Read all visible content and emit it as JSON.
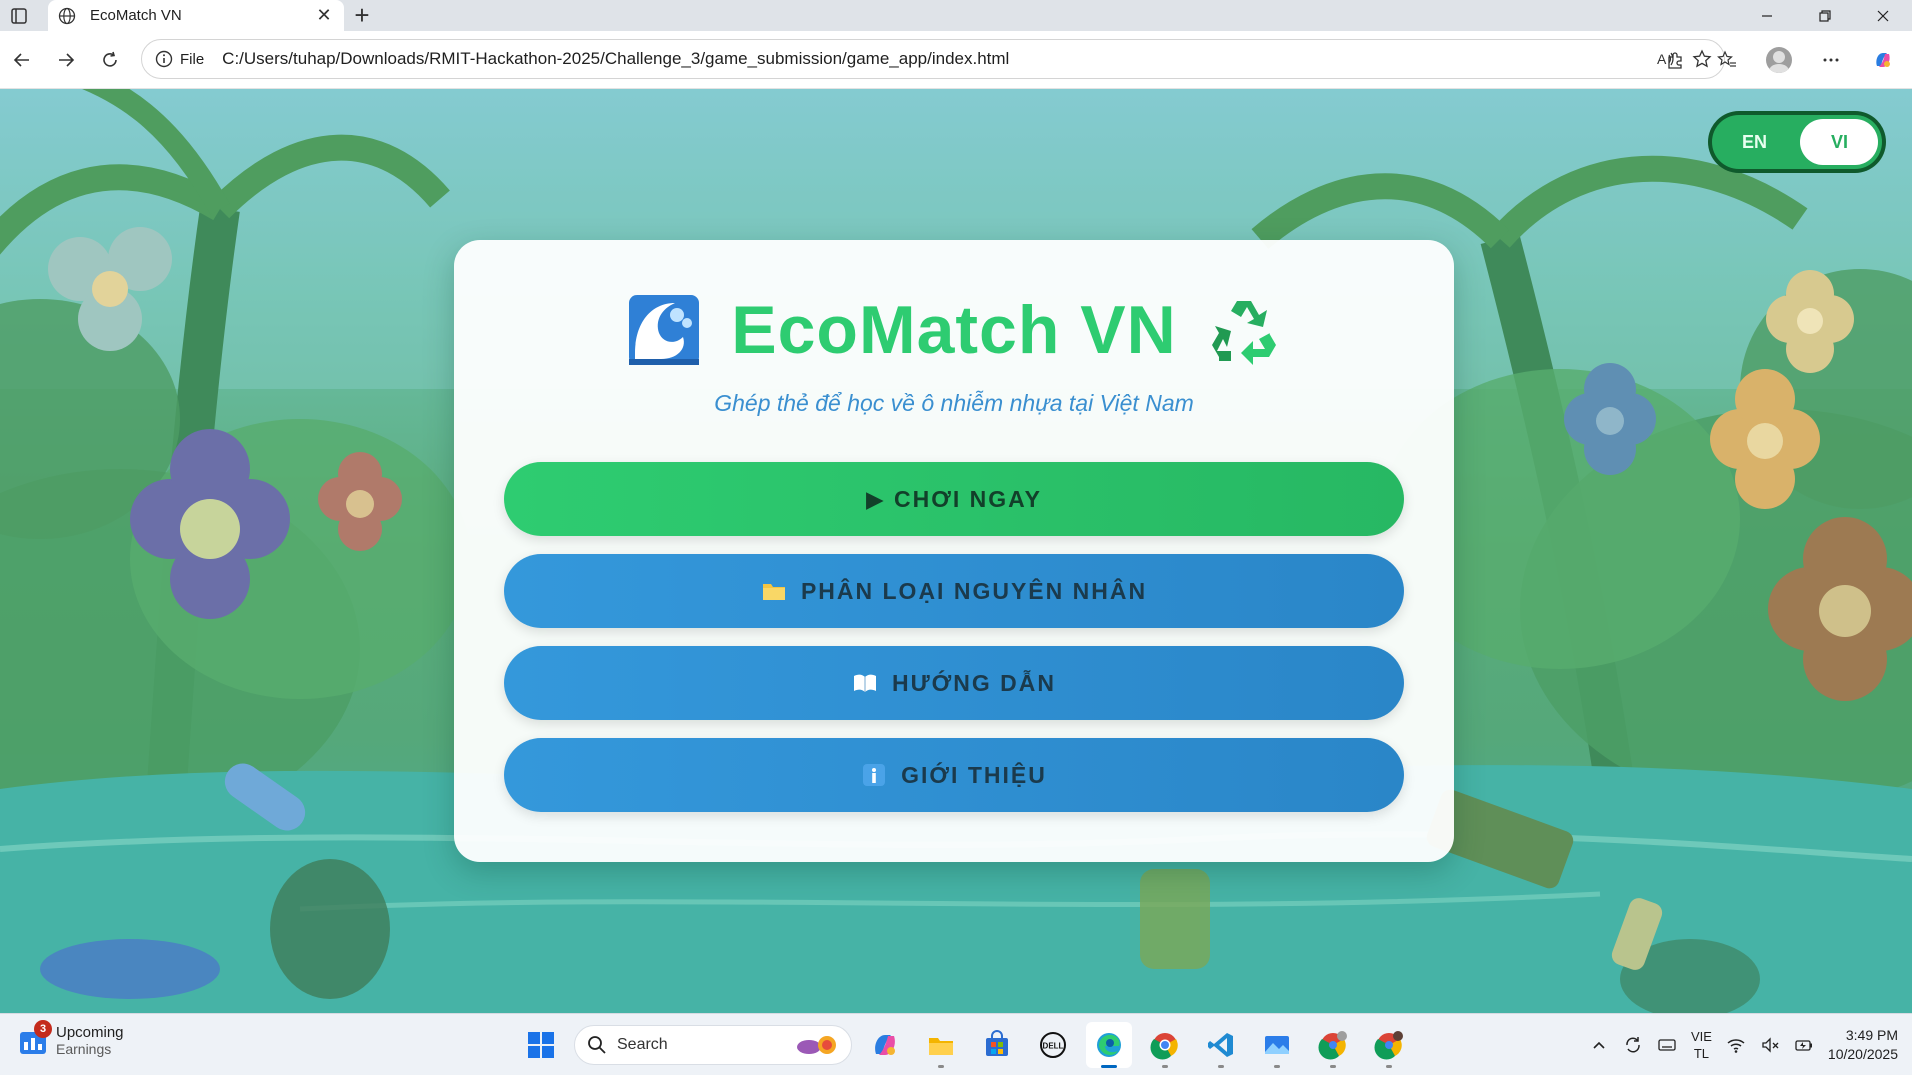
{
  "browser": {
    "tab_title": "EcoMatch VN",
    "address_scheme": "File",
    "address_url": "C:/Users/tuhap/Downloads/RMIT-Hackathon-2025/Challenge_3/game_submission/game_app/index.html"
  },
  "page": {
    "lang_toggle": {
      "options": [
        "EN",
        "VI"
      ],
      "selected": "VI"
    },
    "title": "EcoMatch VN",
    "subtitle": "Ghép thẻ để học về ô nhiễm nhựa tại Việt Nam",
    "buttons": {
      "play": "▶ CHƠI NGAY",
      "classify": "PHÂN LOẠI NGUYÊN NHÂN",
      "guide": "HƯỚNG DẪN",
      "about": "GIỚI THIỆU"
    },
    "icons": {
      "title_left": "water-wave-icon",
      "title_right": "recycle-icon",
      "classify": "folder-icon",
      "guide": "book-icon",
      "about": "info-icon"
    },
    "colors": {
      "title_green": "#2ecc71",
      "play_green": "#2ecc71",
      "menu_blue": "#3498db",
      "subtitle_blue": "#3a8fd0"
    }
  },
  "taskbar": {
    "widget_badge": "3",
    "widget_title": "Upcoming",
    "widget_subtitle": "Earnings",
    "search_label": "Search",
    "lang_line1": "VIE",
    "lang_line2": "TL",
    "time": "3:49 PM",
    "date": "10/20/2025"
  }
}
